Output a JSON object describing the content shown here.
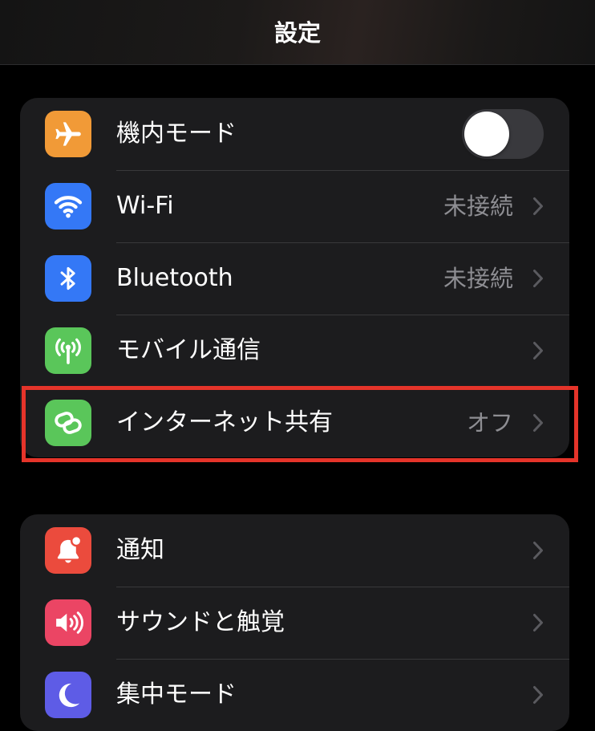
{
  "header": {
    "title": "設定"
  },
  "groups": [
    {
      "items": [
        {
          "label": "機内モード",
          "icon": "airplane-icon",
          "icon_bg": "#f19a37",
          "control": "toggle",
          "toggle_on": false
        },
        {
          "label": "Wi-Fi",
          "icon": "wifi-icon",
          "icon_bg": "#3478f6",
          "value": "未接続"
        },
        {
          "label": "Bluetooth",
          "icon": "bluetooth-icon",
          "icon_bg": "#3478f6",
          "value": "未接続"
        },
        {
          "label": "モバイル通信",
          "icon": "antenna-icon",
          "icon_bg": "#5ac65a"
        },
        {
          "label": "インターネット共有",
          "icon": "chain-link-icon",
          "icon_bg": "#5ac65a",
          "value": "オフ",
          "highlighted": true
        }
      ]
    },
    {
      "items": [
        {
          "label": "通知",
          "icon": "bell-icon",
          "icon_bg": "#eb4b3d"
        },
        {
          "label": "サウンドと触覚",
          "icon": "speaker-icon",
          "icon_bg": "#eb4564"
        },
        {
          "label": "集中モード",
          "icon": "moon-icon",
          "icon_bg": "#5e5ce6"
        }
      ]
    }
  ],
  "colors": {
    "background": "#000000",
    "cell_background": "#1c1c1e",
    "secondary_text": "#8e8e93",
    "highlight_border": "#e5342a"
  }
}
